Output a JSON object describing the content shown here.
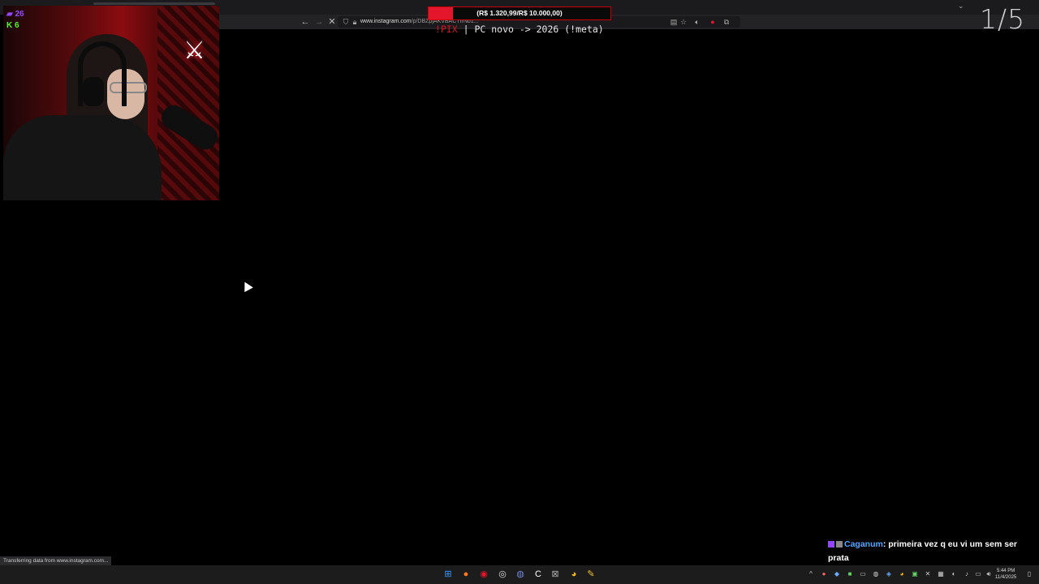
{
  "browser": {
    "url_domain": "www.instagram.com",
    "url_path": "/p/DBZpjAKVBACTIrNb1...",
    "status_text": "Transferring data from www.instagram.com..."
  },
  "stream": {
    "goal_text": "(R$ 1.320,99/R$ 10.000,00)",
    "goal_progress": 0.132,
    "ticker_pix": "!PIX",
    "ticker_text": " | PC novo -> 2026 (!meta)",
    "twitch_viewers": "26",
    "kick_viewers": "6",
    "counter": "1/5"
  },
  "chat": {
    "username": "Caganum",
    "message": "primeira vez q eu vi um sem ser prata"
  },
  "taskbar": {
    "time": "5:44 PM",
    "date": "11/4/2025"
  },
  "colors": {
    "goal_fill": "#e3162b",
    "twitch": "#9146ff",
    "kick": "#53fc18",
    "chat_user": "#4da6ff"
  }
}
